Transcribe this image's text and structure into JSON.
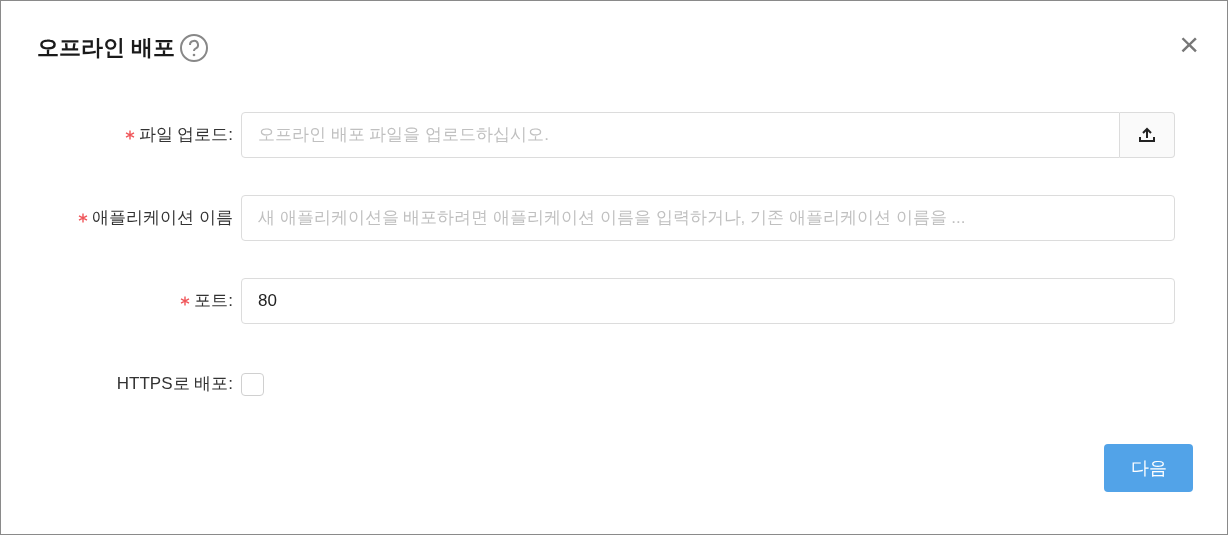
{
  "dialog": {
    "title": "오프라인 배포",
    "close": "×"
  },
  "fields": [
    {
      "kind": "upload",
      "label": "파일 업로드:",
      "required": true,
      "placeholder": "오프라인 배포 파일을 업로드하십시오."
    },
    {
      "kind": "text",
      "label": "애플리케이션 이름",
      "required": true,
      "placeholder": "새 애플리케이션을 배포하려면 애플리케이션 이름을 입력하거나, 기존 애플리케이션 이름을 ..."
    },
    {
      "kind": "text",
      "label": "포트:",
      "required": true,
      "value": "80"
    },
    {
      "kind": "checkbox",
      "label": "HTTPS로 배포:",
      "required": false,
      "checked": false
    }
  ],
  "buttons": [
    {
      "label": "다음"
    }
  ]
}
